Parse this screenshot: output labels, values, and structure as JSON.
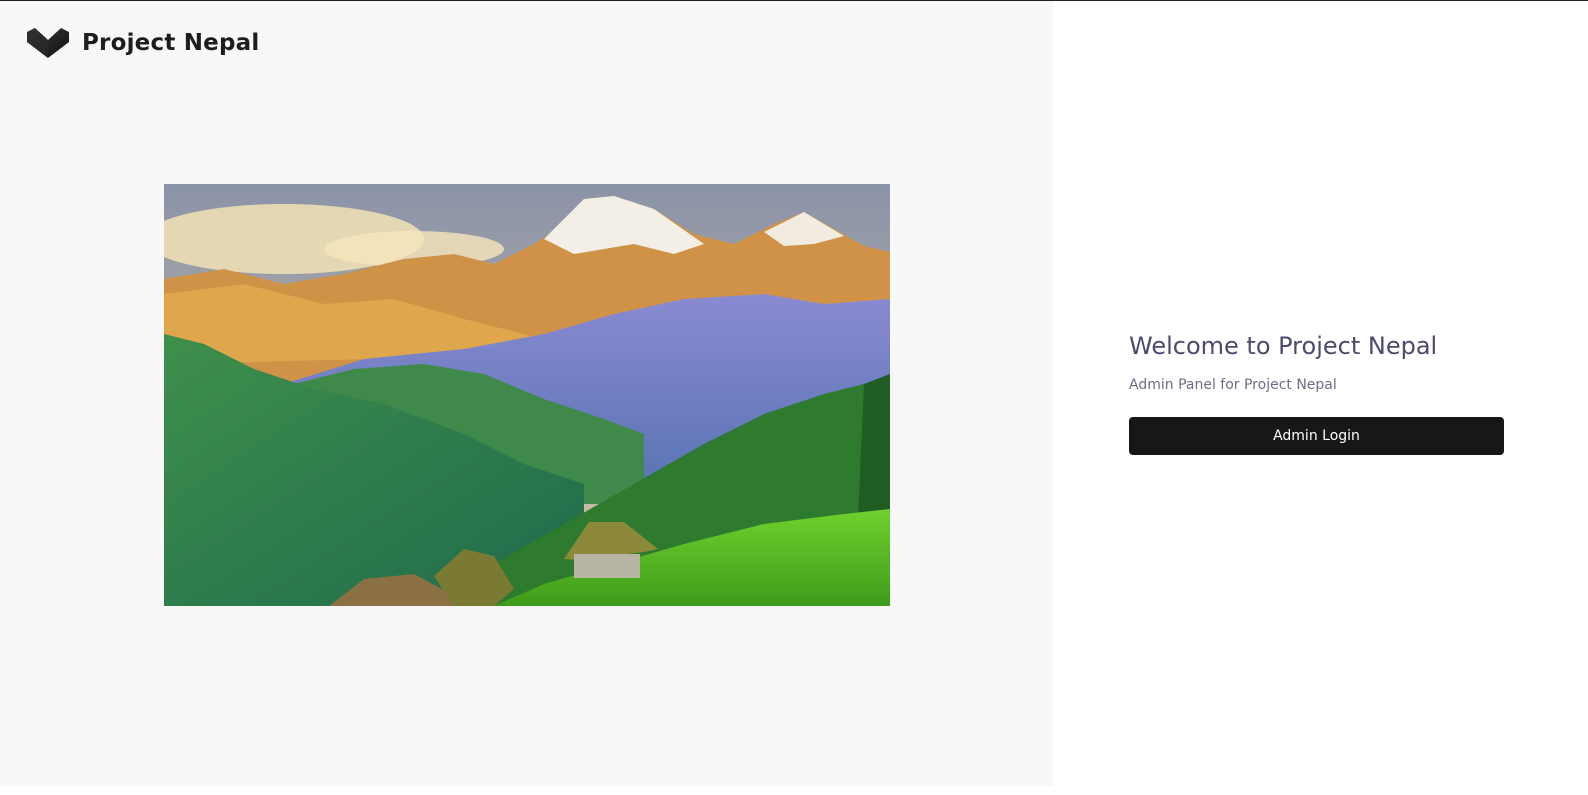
{
  "brand": {
    "name": "Project Nepal",
    "logo_icon": "heart-chevron-logo-icon"
  },
  "hero": {
    "image_alt": "Himalayan mountains with green hills and thatched huts",
    "colors": {
      "sky": "#9aa4b8",
      "snow": "#f4efe6",
      "rock": "#d69c4a",
      "forest": "#2f7a3c",
      "field": "#67c02a"
    }
  },
  "welcome": {
    "title": "Welcome to Project Nepal",
    "subtitle": "Admin Panel for Project Nepal",
    "login_label": "Admin Login"
  },
  "colors": {
    "left_bg": "#f8f8f8",
    "right_bg": "#ffffff",
    "button_bg": "#171717",
    "title_color": "#4a4b6e"
  }
}
